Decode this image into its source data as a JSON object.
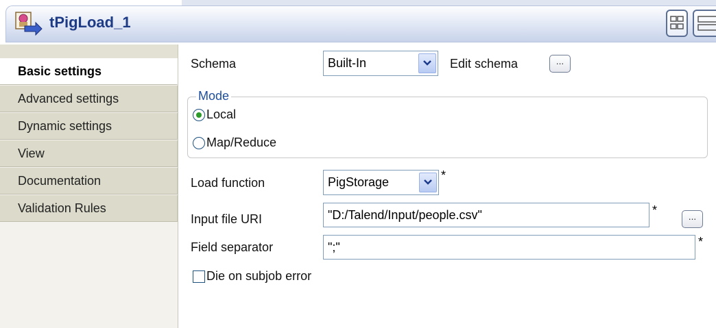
{
  "header": {
    "title": "tPigLoad_1"
  },
  "sidebar": {
    "items": [
      {
        "label": "Basic settings",
        "active": true
      },
      {
        "label": "Advanced settings"
      },
      {
        "label": "Dynamic settings"
      },
      {
        "label": "View"
      },
      {
        "label": "Documentation"
      },
      {
        "label": "Validation Rules"
      }
    ]
  },
  "form": {
    "schema": {
      "label": "Schema",
      "value": "Built-In",
      "edit_label": "Edit schema",
      "edit_button": "..."
    },
    "mode": {
      "legend": "Mode",
      "options": [
        {
          "label": "Local",
          "selected": true
        },
        {
          "label": "Map/Reduce",
          "selected": false
        }
      ]
    },
    "load_function": {
      "label": "Load function",
      "value": "PigStorage",
      "required": "*"
    },
    "input_file": {
      "label": "Input file URI",
      "value": "\"D:/Talend/Input/people.csv\"",
      "required": "*",
      "button": "..."
    },
    "field_separator": {
      "label": "Field separator",
      "value": "\";\"",
      "required": "*"
    },
    "die_on_error": {
      "label": "Die on subjob error",
      "checked": false
    }
  }
}
